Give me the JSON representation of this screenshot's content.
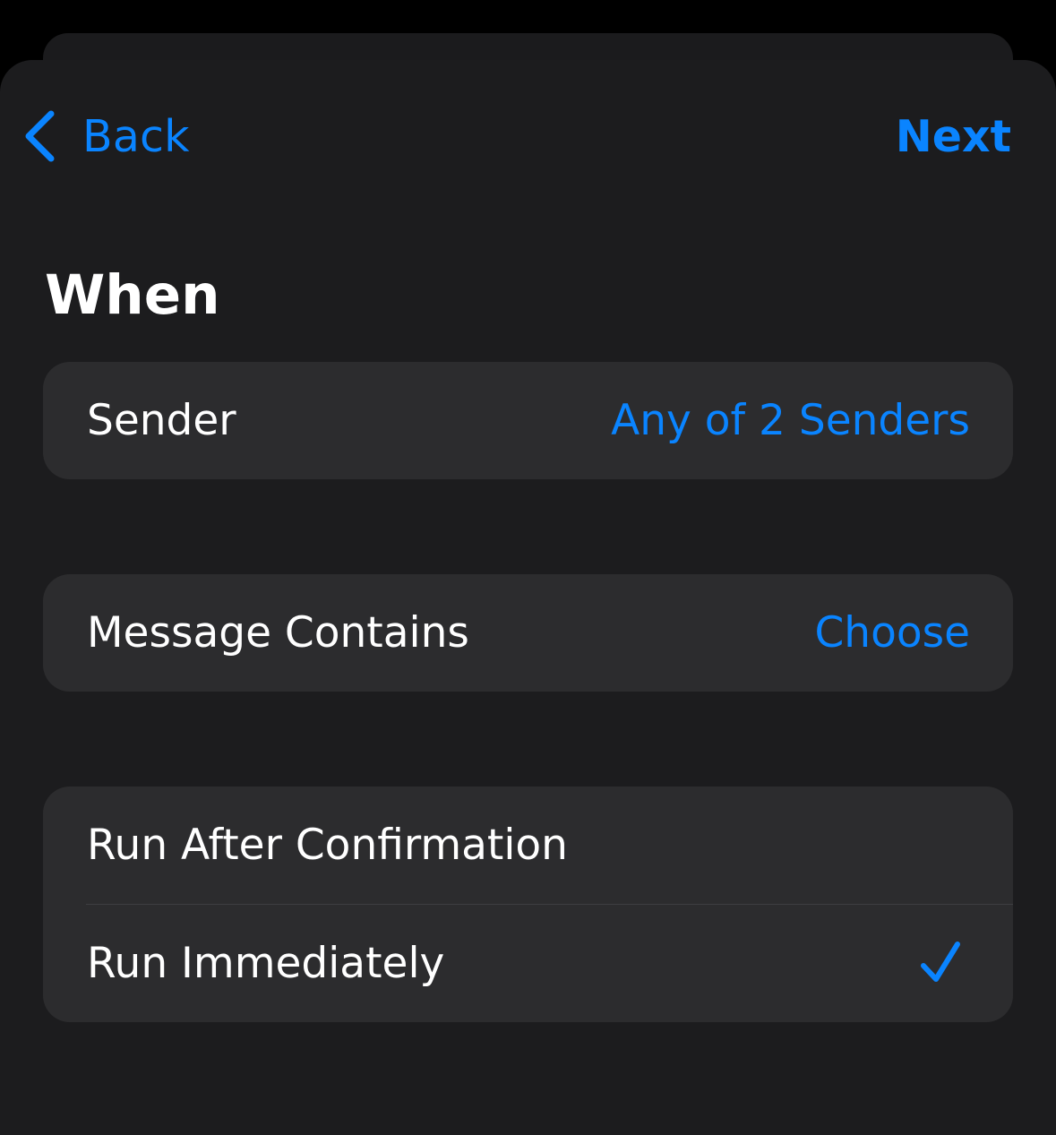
{
  "nav": {
    "back_label": "Back",
    "next_label": "Next"
  },
  "section": {
    "title": "When"
  },
  "sender": {
    "label": "Sender",
    "value": "Any of 2 Senders"
  },
  "message": {
    "label": "Message Contains",
    "value": "Choose"
  },
  "run_options": [
    {
      "label": "Run After Confirmation",
      "selected": false
    },
    {
      "label": "Run Immediately",
      "selected": true
    }
  ],
  "colors": {
    "accent": "#0a84ff",
    "sheet_background": "#1c1c1e",
    "cell_background": "#2c2c2e",
    "text_primary": "#ffffff"
  },
  "icons": {
    "back": "chevron-left-icon",
    "selected": "checkmark-icon"
  }
}
